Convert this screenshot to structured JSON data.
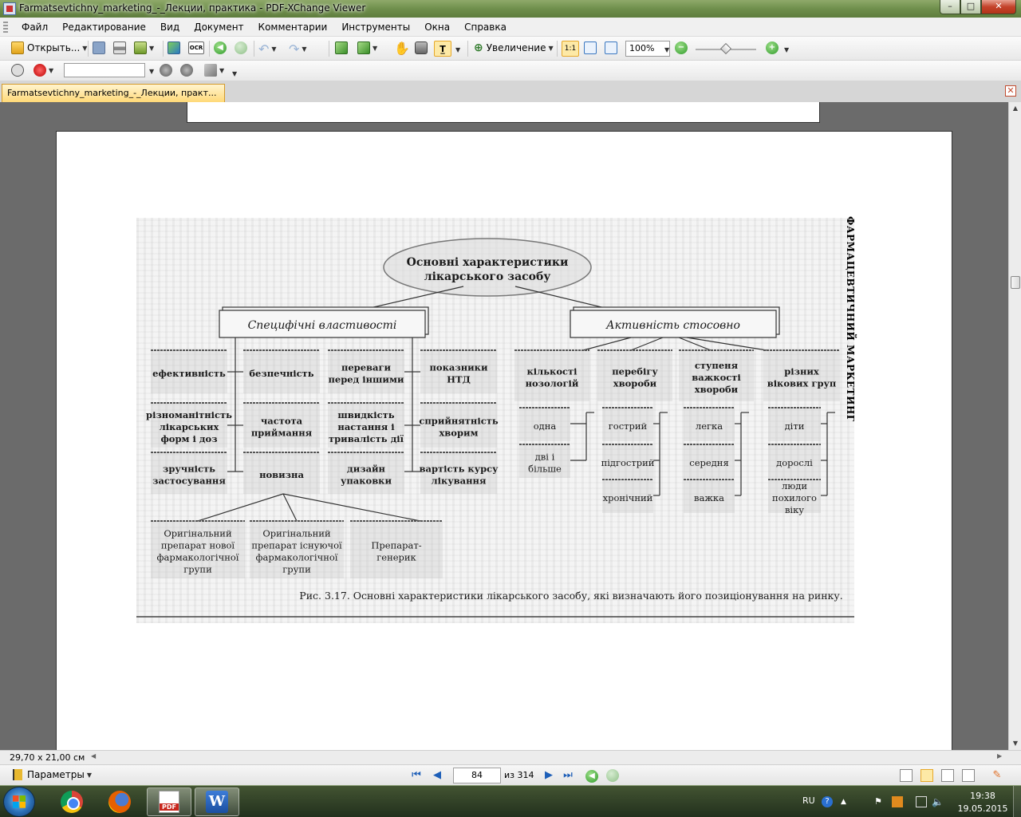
{
  "window": {
    "title": "Farmatsevtichny_marketing_-_Лекции, практика - PDF-XChange Viewer",
    "controls": {
      "minimize": "–",
      "maximize": "□",
      "close": "✕"
    }
  },
  "menu": [
    "Файл",
    "Редактирование",
    "Вид",
    "Документ",
    "Комментарии",
    "Инструменты",
    "Окна",
    "Справка"
  ],
  "toolbar": {
    "open_label": "Открыть...",
    "ocr_label": "OCR",
    "zoom_label": "Увеличение",
    "zoom_value": "100%",
    "zoom_slider_level": 0.5,
    "search_value": ""
  },
  "tab": {
    "label": "Farmatsevtichny_marketing_-_Лекции, практ..."
  },
  "document": {
    "side_header": "ФАРМАЦЕВТИЧНИЙ МАРКЕТИНГ",
    "diagram": {
      "root": [
        "Основні характеристики",
        "лікарського засобу"
      ],
      "left_branch": "Специфічні властивості",
      "right_branch": "Активність стосовно",
      "left_columns": [
        [
          "ефективність"
        ],
        [
          "безпечність"
        ],
        [
          "переваги",
          "перед іншими"
        ],
        [
          "показники",
          "НТД"
        ]
      ],
      "left_row2": [
        [
          "різноманітність",
          "лікарських",
          "форм і доз"
        ],
        [
          "частота",
          "приймання"
        ],
        [
          "швидкість",
          "настання і",
          "тривалість дії"
        ],
        [
          "сприйнятність",
          "хворим"
        ]
      ],
      "left_row3": [
        [
          "зручність",
          "застосування"
        ],
        [
          "новизна"
        ],
        [
          "дизайн",
          "упаковки"
        ],
        [
          "вартість курсу",
          "лікування"
        ]
      ],
      "novelty_children": [
        [
          "Оригінальний",
          "препарат нової",
          "фармакологічної",
          "групи"
        ],
        [
          "Оригінальний",
          "препарат існуючої",
          "фармакологічної",
          "групи"
        ],
        [
          "Препарат-",
          "генерик"
        ]
      ],
      "right_columns": [
        {
          "head": [
            "кількості",
            "нозологій"
          ],
          "items": [
            [
              "одна"
            ],
            [
              "дві і",
              "більше"
            ]
          ]
        },
        {
          "head": [
            "перебігу",
            "хвороби"
          ],
          "items": [
            [
              "гострий"
            ],
            [
              "підгострий"
            ],
            [
              "хронічний"
            ]
          ]
        },
        {
          "head": [
            "ступеня",
            "важкості",
            "хвороби"
          ],
          "items": [
            [
              "легка"
            ],
            [
              "середня"
            ],
            [
              "важка"
            ]
          ]
        },
        {
          "head": [
            "різних",
            "вікових груп"
          ],
          "items": [
            [
              "діти"
            ],
            [
              "дорослі"
            ],
            [
              "люди",
              "похилого",
              "віку"
            ]
          ]
        }
      ],
      "caption": "Рис. 3.17. Основні характеристики лікарського засобу, які визначають його позиціонування на ринку."
    }
  },
  "status": {
    "page_size": "29,70 x 21,00 см"
  },
  "navigation": {
    "params_label": "Параметры",
    "current_page": "84",
    "total_label": "из 314"
  },
  "taskbar": {
    "language": "RU",
    "time": "19:38",
    "date": "19.05.2015"
  },
  "colors": {
    "accent_tab": "#ffd978",
    "nav_blue": "#1e5fb8",
    "green_button": "#2f9a2a"
  }
}
